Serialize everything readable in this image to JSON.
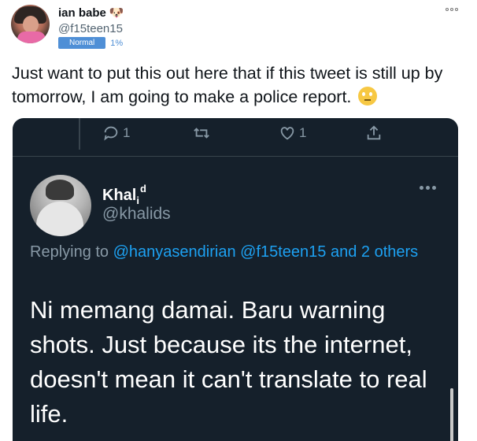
{
  "author": {
    "display_name": "ian babe",
    "name_icon": "dog-face-icon",
    "handle": "@f15teen15",
    "badge": "Normal",
    "percent": "1%"
  },
  "tweet": {
    "text": "Just want to put this out here that if this tweet is still up by tomorrow, I am going to make a police report.",
    "emoji_icon": "rolling-eyes-face-icon"
  },
  "embedded": {
    "actions": [
      {
        "icon": "reply-icon",
        "count": "1"
      },
      {
        "icon": "retweet-icon",
        "count": ""
      },
      {
        "icon": "like-icon",
        "count": "1"
      },
      {
        "icon": "share-icon",
        "count": ""
      }
    ],
    "name_main": "Khal",
    "name_sub": "i",
    "name_sup": "d",
    "handle": "@khalids",
    "replying_prefix": "Replying to",
    "replying_links": "@hanyasendirian @f15teen15 and 2 others",
    "body": "Ni memang damai. Baru warning shots. Just because its the internet, doesn't mean it can't translate to real life.",
    "colors": {
      "background": "#15202b",
      "link": "#1da1f2",
      "muted": "#8899a6"
    }
  }
}
